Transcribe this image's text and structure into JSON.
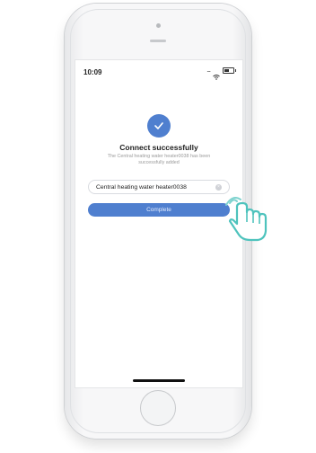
{
  "status_bar": {
    "time": "10:09"
  },
  "connect": {
    "title": "Connect successfully",
    "subtitle": "The Central heating water heater0038 has been successfully added"
  },
  "device_name": {
    "value": "Central heating water heater0038"
  },
  "actions": {
    "complete_label": "Complete"
  },
  "colors": {
    "accent": "#4f7fcf",
    "text": "#1d1d1d",
    "muted": "#9a9a9a"
  }
}
